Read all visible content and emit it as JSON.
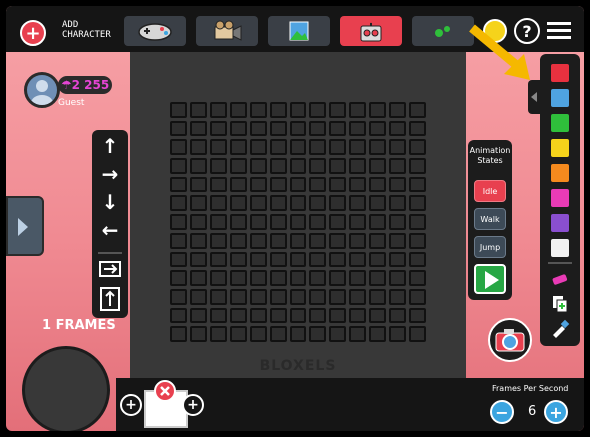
{
  "header": {
    "add_button": "+",
    "add_label_line1": "ADD",
    "add_label_line2": "CHARACTER",
    "tabs": [
      {
        "name": "game-controller",
        "active": false
      },
      {
        "name": "camera-film",
        "active": false
      },
      {
        "name": "gallery",
        "active": false
      },
      {
        "name": "robot-character",
        "active": true
      },
      {
        "name": "art",
        "active": false
      }
    ],
    "help_label": "?"
  },
  "profile": {
    "coins": "☂2 255",
    "user": "Guest"
  },
  "arrows": {
    "up": "↑",
    "right": "→",
    "down": "↓",
    "left": "←"
  },
  "board": {
    "rows": 13,
    "cols": 13,
    "label": "BLOXELS"
  },
  "animation_states": {
    "title_line1": "Animation",
    "title_line2": "States",
    "states": [
      {
        "label": "Idle",
        "active": true
      },
      {
        "label": "Walk",
        "active": false
      },
      {
        "label": "Jump",
        "active": false
      }
    ]
  },
  "palette": {
    "colors": [
      "#e8313f",
      "#4fa3e0",
      "#2fbf3b",
      "#f5d31b",
      "#f58a1e",
      "#e93bb6",
      "#8a4fd0",
      "#f2f2f2"
    ],
    "tools": [
      "eraser-icon",
      "copy-icon",
      "dropper-icon"
    ]
  },
  "frames": {
    "label": "1 FRAMES",
    "count_label": "Frames Per Second",
    "fps": "6",
    "minus": "−",
    "plus": "+"
  }
}
